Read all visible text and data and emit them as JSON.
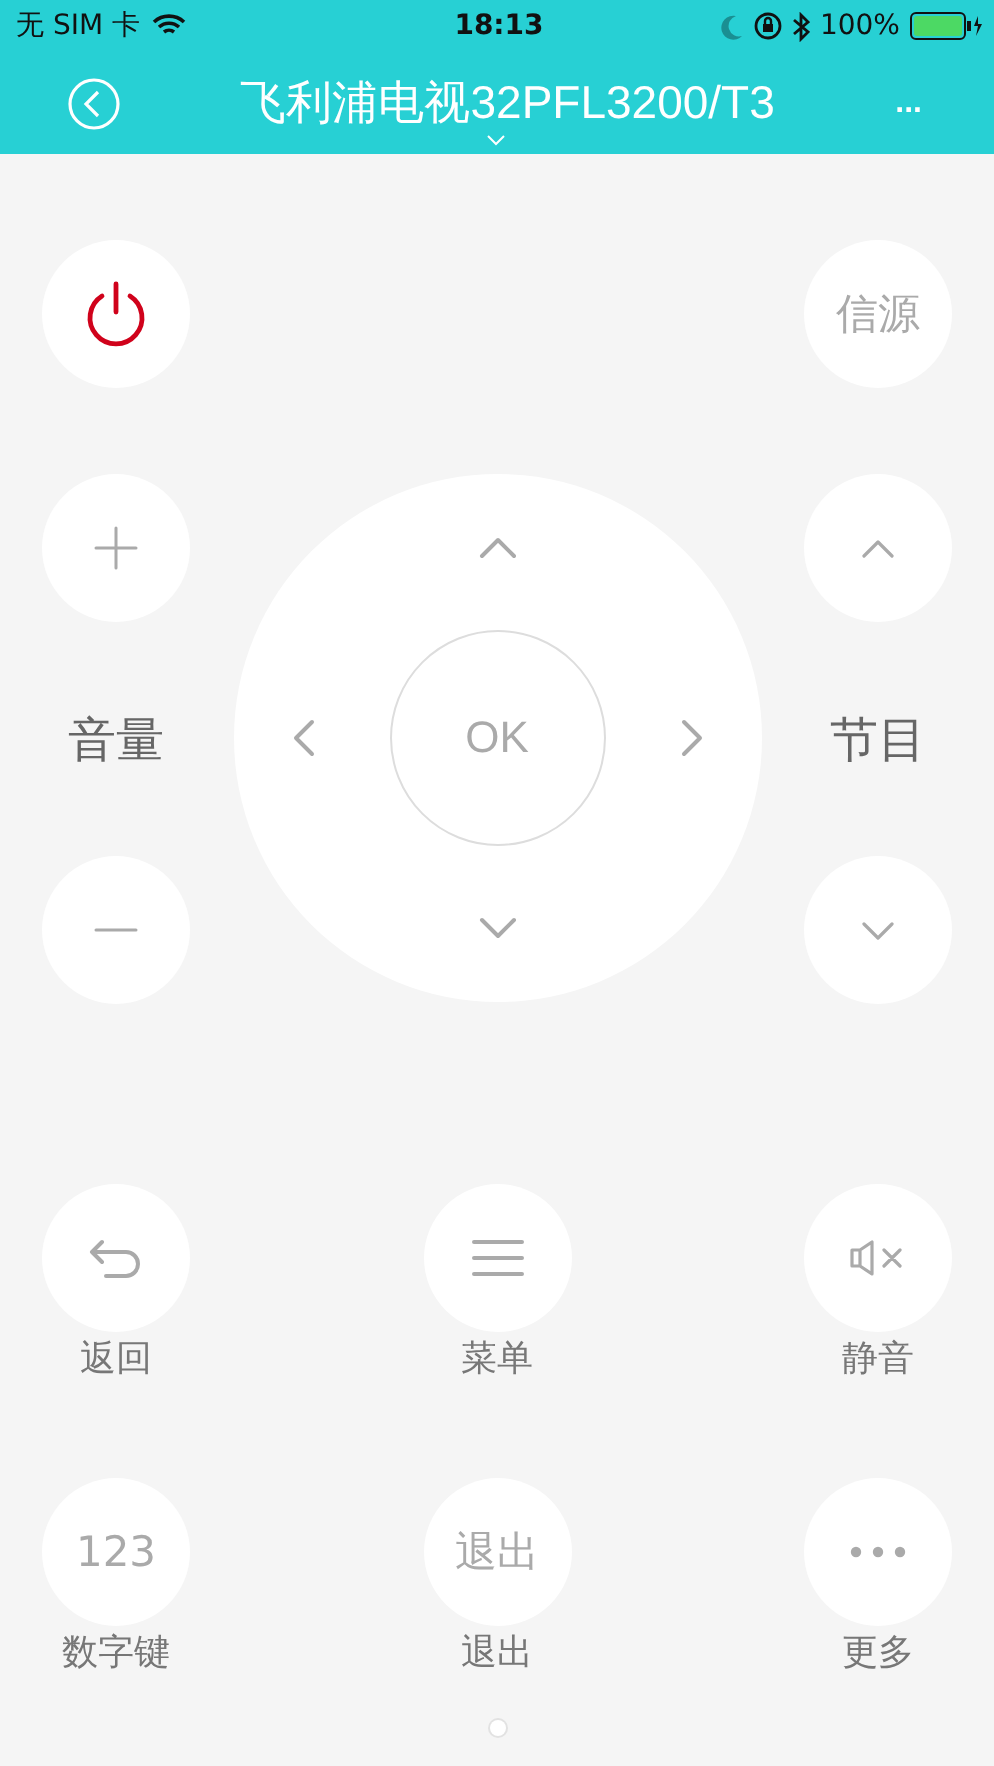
{
  "status_bar": {
    "carrier": "无 SIM 卡",
    "time": "18:13",
    "battery": "100%"
  },
  "nav": {
    "title": "飞利浦电视32PFL3200/T3",
    "more": "..."
  },
  "top_buttons": [
    {
      "kind": "power"
    },
    {
      "kind": "text",
      "face": "信源"
    }
  ],
  "volume": {
    "label": "音量"
  },
  "channel": {
    "label": "节目"
  },
  "dpad": {
    "ok": "OK"
  },
  "buttons": [
    {
      "kind": "back",
      "label": "返回"
    },
    {
      "kind": "menu",
      "label": "菜单"
    },
    {
      "kind": "mute",
      "label": "静音"
    },
    {
      "kind": "text",
      "face": "123",
      "label": "数字键"
    },
    {
      "kind": "text",
      "face": "退出",
      "label": "退出"
    },
    {
      "kind": "more",
      "label": "更多"
    }
  ],
  "pager": [
    {
      "selected": true
    }
  ]
}
